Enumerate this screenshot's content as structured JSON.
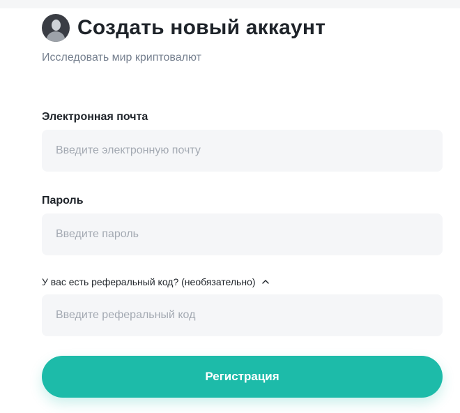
{
  "header": {
    "title": "Создать новый аккаунт",
    "subtitle": "Исследовать мир криптовалют"
  },
  "form": {
    "email": {
      "label": "Электронная почта",
      "placeholder": "Введите электронную почту"
    },
    "password": {
      "label": "Пароль",
      "placeholder": "Введите пароль"
    },
    "referral": {
      "toggle_label": "У вас есть реферальный код? (необязательно)",
      "placeholder": "Введите реферальный код",
      "expanded": true
    },
    "submit_label": "Регистрация"
  },
  "colors": {
    "accent": "#1dbba9",
    "input_bg": "#f5f6f8",
    "text": "#1e2329",
    "muted": "#76808f",
    "placeholder": "#a3a9b2"
  },
  "icons": {
    "avatar": "user-avatar-icon",
    "referral_toggle": "chevron-up-icon"
  }
}
